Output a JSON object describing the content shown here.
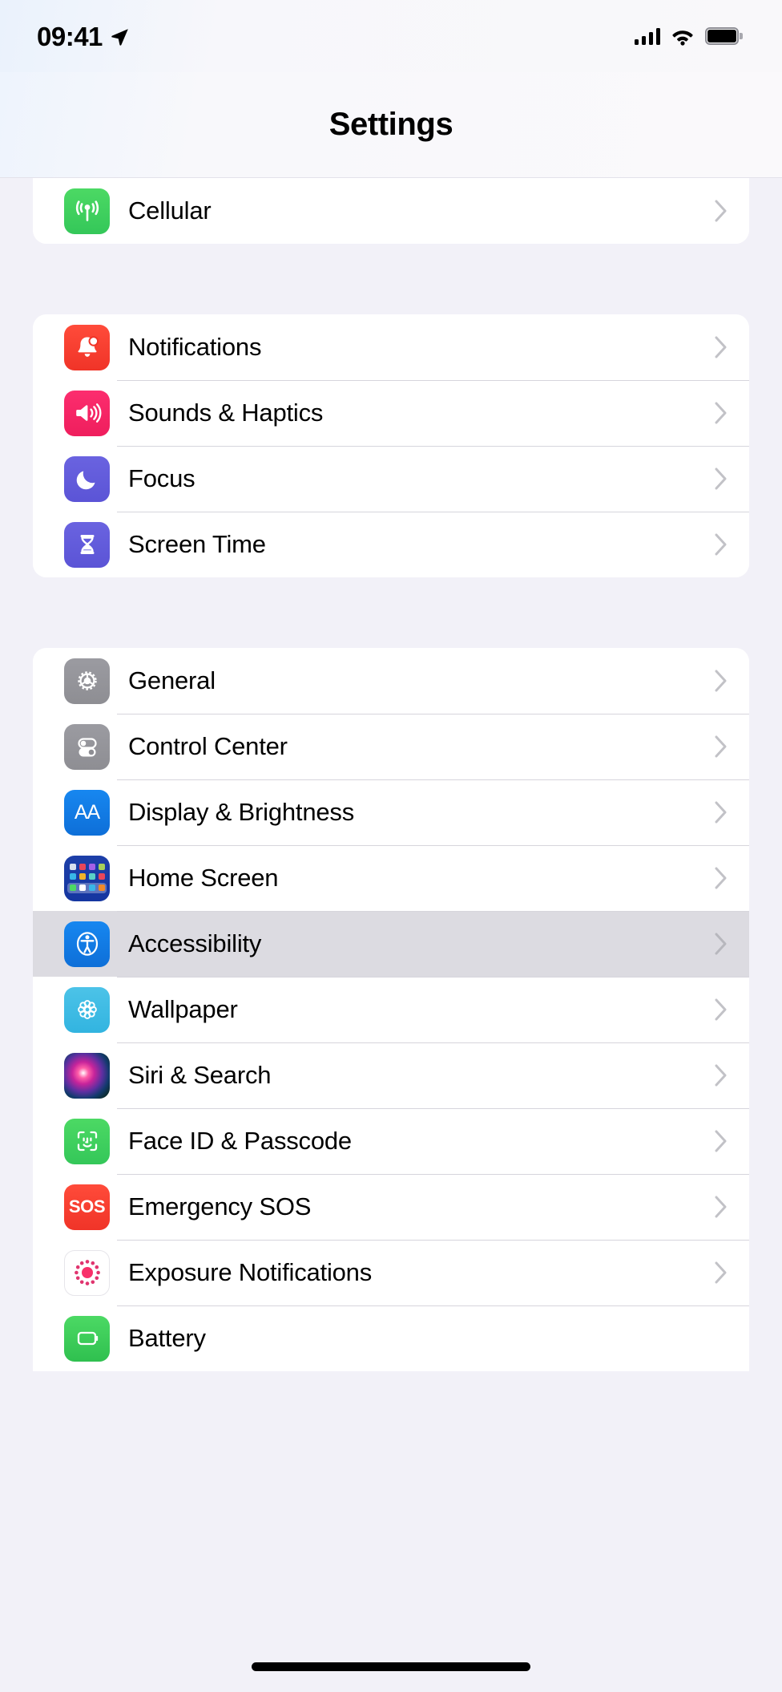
{
  "status_bar": {
    "time": "09:41",
    "location_icon": "location-arrow-icon",
    "cellular_icon": "cellular-signal-icon",
    "wifi_icon": "wifi-icon",
    "battery_icon": "battery-full-icon"
  },
  "nav": {
    "title": "Settings"
  },
  "colors": {
    "background": "#f2f1f8",
    "card": "#ffffff",
    "separator": "#d6d5dc",
    "selected_row": "#dcdbe1",
    "chevron": "#c2c2c7",
    "label": "#000000"
  },
  "sections": [
    {
      "id": "connectivity",
      "clipped_top": true,
      "rows": [
        {
          "label": "Cellular",
          "icon": "cellular-tower-icon",
          "icon_color": "#34c759",
          "selected": false,
          "chevron": true
        }
      ]
    },
    {
      "id": "alerts",
      "rows": [
        {
          "label": "Notifications",
          "icon": "bell-badge-icon",
          "icon_color": "#f03428",
          "selected": false,
          "chevron": true
        },
        {
          "label": "Sounds & Haptics",
          "icon": "speaker-wave-icon",
          "icon_color": "#ef1e5d",
          "selected": false,
          "chevron": true
        },
        {
          "label": "Focus",
          "icon": "moon-icon",
          "icon_color": "#5b54d6",
          "selected": false,
          "chevron": true
        },
        {
          "label": "Screen Time",
          "icon": "hourglass-icon",
          "icon_color": "#5b54d6",
          "selected": false,
          "chevron": true
        }
      ]
    },
    {
      "id": "system",
      "clipped_bottom": true,
      "rows": [
        {
          "label": "General",
          "icon": "gear-icon",
          "icon_color": "#8e8e93",
          "selected": false,
          "chevron": true
        },
        {
          "label": "Control Center",
          "icon": "toggles-icon",
          "icon_color": "#8e8e93",
          "selected": false,
          "chevron": true
        },
        {
          "label": "Display & Brightness",
          "icon": "text-size-aa-icon",
          "icon_color": "#0a6fe8",
          "selected": false,
          "chevron": true
        },
        {
          "label": "Home Screen",
          "icon": "app-grid-icon",
          "icon_color": "#1536a0",
          "selected": false,
          "chevron": true
        },
        {
          "label": "Accessibility",
          "icon": "accessibility-icon",
          "icon_color": "#0e6fd8",
          "selected": true,
          "chevron": true
        },
        {
          "label": "Wallpaper",
          "icon": "flower-icon",
          "icon_color": "#32b4e0",
          "selected": false,
          "chevron": true
        },
        {
          "label": "Siri & Search",
          "icon": "siri-orb-icon",
          "icon_color": "#c7249b",
          "selected": false,
          "chevron": true
        },
        {
          "label": "Face ID & Passcode",
          "icon": "face-id-icon",
          "icon_color": "#34c759",
          "selected": false,
          "chevron": true
        },
        {
          "label": "Emergency SOS",
          "icon": "sos-icon",
          "icon_color": "#f03428",
          "selected": false,
          "chevron": true
        },
        {
          "label": "Exposure Notifications",
          "icon": "exposure-dots-icon",
          "icon_color": "#f8306a",
          "selected": false,
          "chevron": true
        },
        {
          "label": "Battery",
          "icon": "battery-icon",
          "icon_color": "#2fc04f",
          "selected": false,
          "chevron": false
        }
      ]
    }
  ],
  "home_indicator": "home-indicator-bar"
}
